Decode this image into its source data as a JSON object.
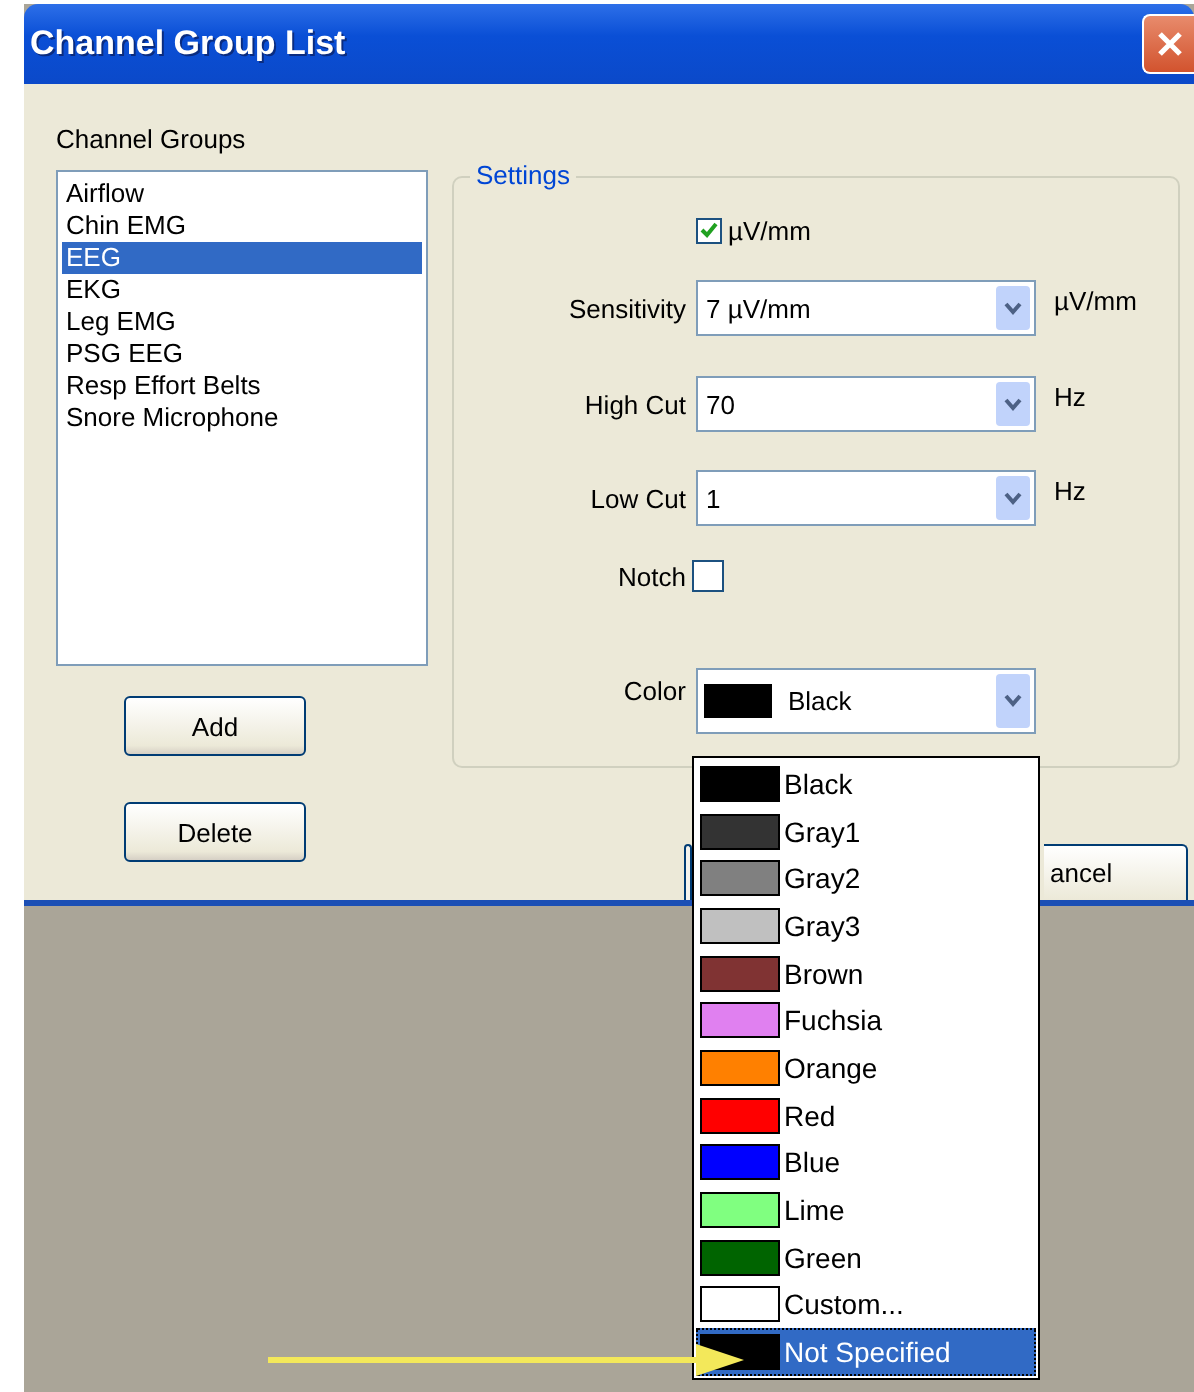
{
  "window": {
    "title": "Channel Group List"
  },
  "channel_groups": {
    "label": "Channel Groups",
    "items": [
      {
        "label": "Airflow",
        "selected": false
      },
      {
        "label": "Chin EMG",
        "selected": false
      },
      {
        "label": "EEG",
        "selected": true
      },
      {
        "label": "EKG",
        "selected": false
      },
      {
        "label": "Leg EMG",
        "selected": false
      },
      {
        "label": "PSG EEG",
        "selected": false
      },
      {
        "label": "Resp Effort Belts",
        "selected": false
      },
      {
        "label": "Snore Microphone",
        "selected": false
      }
    ]
  },
  "list_buttons": [
    "Add",
    "Delete"
  ],
  "settings": {
    "title": "Settings",
    "units_checkbox": {
      "label": "µV/mm",
      "checked": true
    },
    "fields": [
      {
        "label": "Sensitivity",
        "value": "7 µV/mm",
        "unit": "µV/mm"
      },
      {
        "label": "High Cut",
        "value": "70",
        "unit": "Hz"
      },
      {
        "label": "Low Cut",
        "value": "1",
        "unit": "Hz"
      }
    ],
    "notch": {
      "label": "Notch",
      "checked": false
    },
    "color": {
      "label": "Color",
      "value": "Black",
      "color": "#000000"
    }
  },
  "cancel_button": {
    "label": "ancel"
  },
  "color_dropdown": {
    "items": [
      {
        "label": "Black",
        "color": "#000000",
        "selected": false
      },
      {
        "label": "Gray1",
        "color": "#333333",
        "selected": false
      },
      {
        "label": "Gray2",
        "color": "#808080",
        "selected": false
      },
      {
        "label": "Gray3",
        "color": "#c0c0c0",
        "selected": false
      },
      {
        "label": "Brown",
        "color": "#803333",
        "selected": false
      },
      {
        "label": "Fuchsia",
        "color": "#e080f0",
        "selected": false
      },
      {
        "label": "Orange",
        "color": "#ff8000",
        "selected": false
      },
      {
        "label": "Red",
        "color": "#ff0000",
        "selected": false
      },
      {
        "label": "Blue",
        "color": "#0000ff",
        "selected": false
      },
      {
        "label": "Lime",
        "color": "#80ff80",
        "selected": false
      },
      {
        "label": "Green",
        "color": "#006400",
        "selected": false
      },
      {
        "label": "Custom...",
        "color": "#ffffff",
        "selected": false
      },
      {
        "label": "Not Specified",
        "color": "#000000",
        "selected": true
      }
    ]
  }
}
